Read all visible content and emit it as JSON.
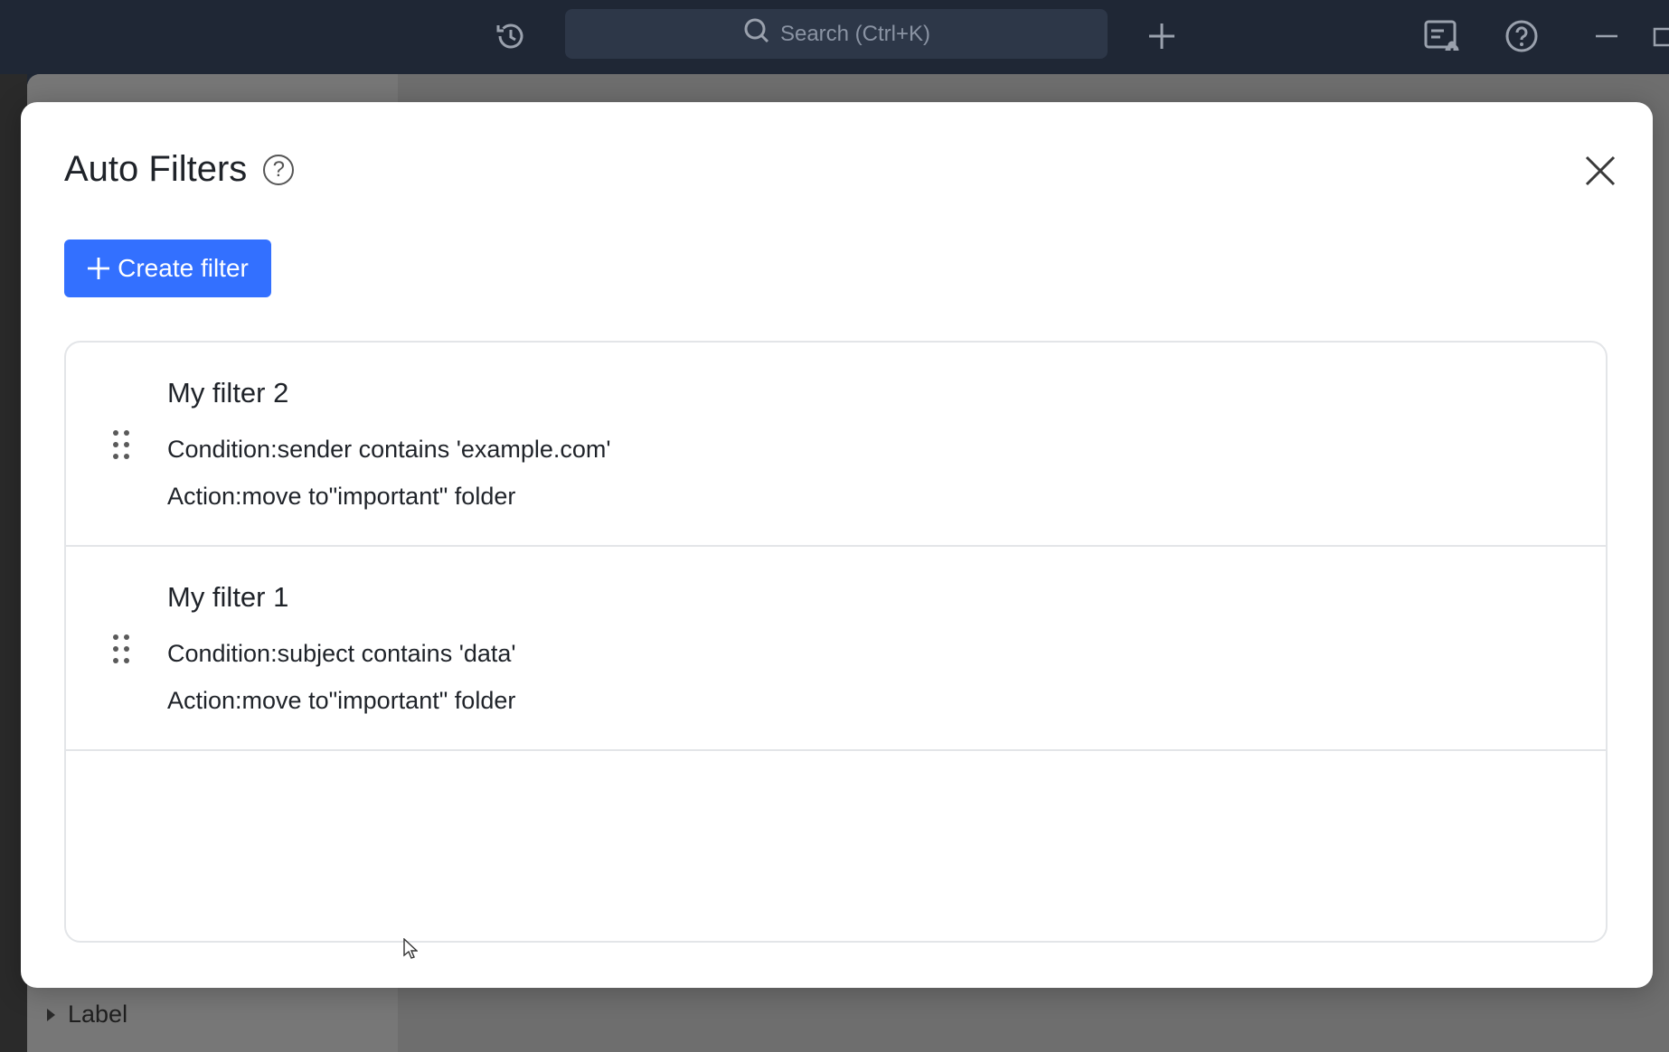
{
  "topbar": {
    "search_placeholder": "Search (Ctrl+K)",
    "icons": [
      "history-icon",
      "search-icon",
      "add-icon",
      "notification-settings-icon",
      "help-icon",
      "minimize-icon",
      "maximize-icon"
    ]
  },
  "background_app": {
    "sidebar_label": "Label"
  },
  "modal": {
    "title": "Auto Filters",
    "create_button_label": "Create filter",
    "filters": [
      {
        "name": "My filter 2",
        "condition": "Condition:sender contains 'example.com'",
        "action": "Action:move to\"important\" folder"
      },
      {
        "name": "My filter 1",
        "condition": "Condition:subject contains 'data'",
        "action": "Action:move to\"important\" folder"
      }
    ]
  },
  "colors": {
    "primary": "#3370ff",
    "topbar": "#1f2735",
    "overlay": "#6e6e6e",
    "border": "#e3e5e8"
  }
}
